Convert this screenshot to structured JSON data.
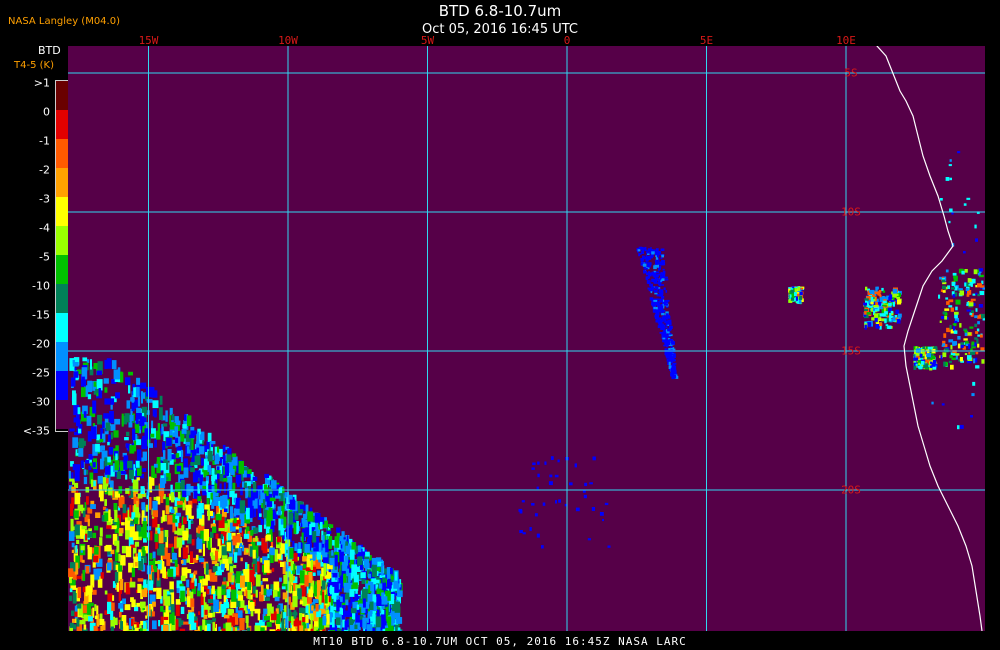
{
  "header": {
    "title": "BTD 6.8-10.7um",
    "subtitle": "Oct 05, 2016 16:45 UTC",
    "org": "NASA Langley (M04.0)"
  },
  "footer": "MT10  BTD 6.8-10.7UM  OCT 05, 2016 16:45Z  NASA LARC",
  "legend": {
    "title": "BTD",
    "units": "T4-5 (K)",
    "labels": [
      ">1",
      "0",
      "-1",
      "-2",
      "-3",
      "-4",
      "-5",
      "-10",
      "-15",
      "-20",
      "-25",
      "-30",
      "<-35"
    ],
    "colors": [
      "#6a0000",
      "#e20000",
      "#ff5a00",
      "#ffa000",
      "#ffff00",
      "#9aff00",
      "#00c000",
      "#008058",
      "#00ffff",
      "#0090ff",
      "#0000ff",
      "#560048"
    ]
  },
  "map": {
    "background": "#560048",
    "grid_color": "#30d8f0",
    "coast_color": "#ffffff",
    "lon_labels": [
      {
        "label": "15W",
        "lon": -15
      },
      {
        "label": "10W",
        "lon": -10
      },
      {
        "label": "5W",
        "lon": -5
      },
      {
        "label": "0",
        "lon": 0
      },
      {
        "label": "5E",
        "lon": 5
      },
      {
        "label": "10E",
        "lon": 10
      }
    ],
    "lat_labels": [
      {
        "label": "5S",
        "lat": -5
      },
      {
        "label": "10S",
        "lat": -10
      },
      {
        "label": "15S",
        "lat": -15
      },
      {
        "label": "20S",
        "lat": -20
      }
    ]
  }
}
